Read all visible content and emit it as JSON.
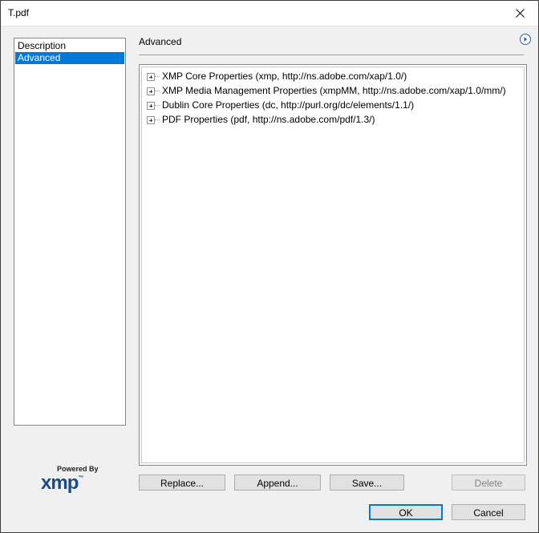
{
  "window": {
    "title": "T.pdf"
  },
  "sidebar": {
    "items": [
      {
        "label": "Description",
        "selected": false
      },
      {
        "label": "Advanced",
        "selected": true
      }
    ]
  },
  "branding": {
    "powered_by": "Powered By",
    "logo_text": "xmp",
    "trademark": "™"
  },
  "panel": {
    "title": "Advanced"
  },
  "tree": {
    "items": [
      {
        "label": "XMP Core Properties (xmp, http://ns.adobe.com/xap/1.0/)"
      },
      {
        "label": "XMP Media Management Properties (xmpMM, http://ns.adobe.com/xap/1.0/mm/)"
      },
      {
        "label": "Dublin Core Properties (dc, http://purl.org/dc/elements/1.1/)"
      },
      {
        "label": "PDF Properties (pdf, http://ns.adobe.com/pdf/1.3/)"
      }
    ]
  },
  "buttons": {
    "replace": "Replace...",
    "append": "Append...",
    "save": "Save...",
    "delete": "Delete",
    "ok": "OK",
    "cancel": "Cancel"
  },
  "colors": {
    "selection": "#0078d7",
    "logo": "#1e4a84",
    "dialog_bg": "#f0f0f0"
  },
  "icons": {
    "close": "close-icon",
    "panel_menu": "chevron-right-circle-icon",
    "expand": "plus-box-icon"
  }
}
